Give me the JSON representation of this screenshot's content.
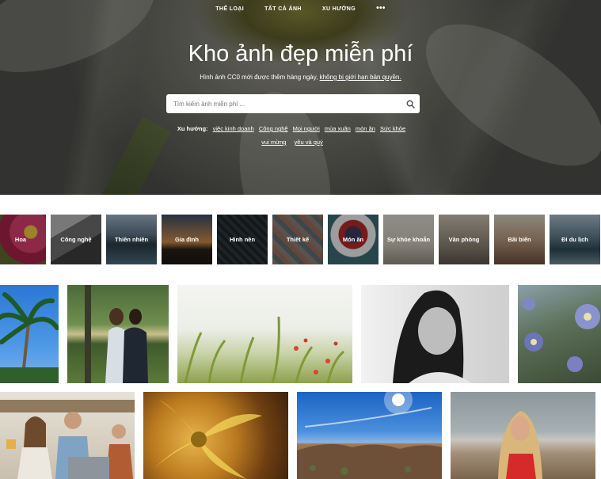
{
  "nav": {
    "items": [
      "THỂ LOẠI",
      "TẤT CẢ ẢNH",
      "XU HƯỚNG"
    ],
    "more": "•••"
  },
  "hero": {
    "title": "Kho ảnh đẹp miễn phí",
    "subtitle": "Hình ảnh CC0 mới được thêm hàng ngày,",
    "subtitle_link": "không bị giới hạn bản quyền."
  },
  "search": {
    "placeholder": "Tìm kiếm ảnh miễn phí ...",
    "icon": "search-icon"
  },
  "trends": {
    "label": "Xu hướng:",
    "tags": [
      "việc kinh doanh",
      "Công nghệ",
      "Mọi người",
      "mùa xuân",
      "món ăn",
      "Sức khỏe",
      "vui mừng",
      "yêu và quý"
    ]
  },
  "categories": [
    {
      "label": "Hoa",
      "color": "#c2325f"
    },
    {
      "label": "Công nghệ",
      "color": "#8a8a8a"
    },
    {
      "label": "Thiên nhiên",
      "color": "#4a6070"
    },
    {
      "label": "Gia đình",
      "color": "#7a4a2a"
    },
    {
      "label": "Hình nền",
      "color": "#2d3338"
    },
    {
      "label": "Thiết kế",
      "color": "#7a6f66"
    },
    {
      "label": "Món ăn",
      "color": "#3c6b74"
    },
    {
      "label": "Sự khỏe khoắn",
      "color": "#b8b4a8"
    },
    {
      "label": "Văn phòng",
      "color": "#9b9286"
    },
    {
      "label": "Bãi biển",
      "color": "#b49a7c"
    },
    {
      "label": "Đi du lịch",
      "color": "#3d5f73"
    }
  ]
}
